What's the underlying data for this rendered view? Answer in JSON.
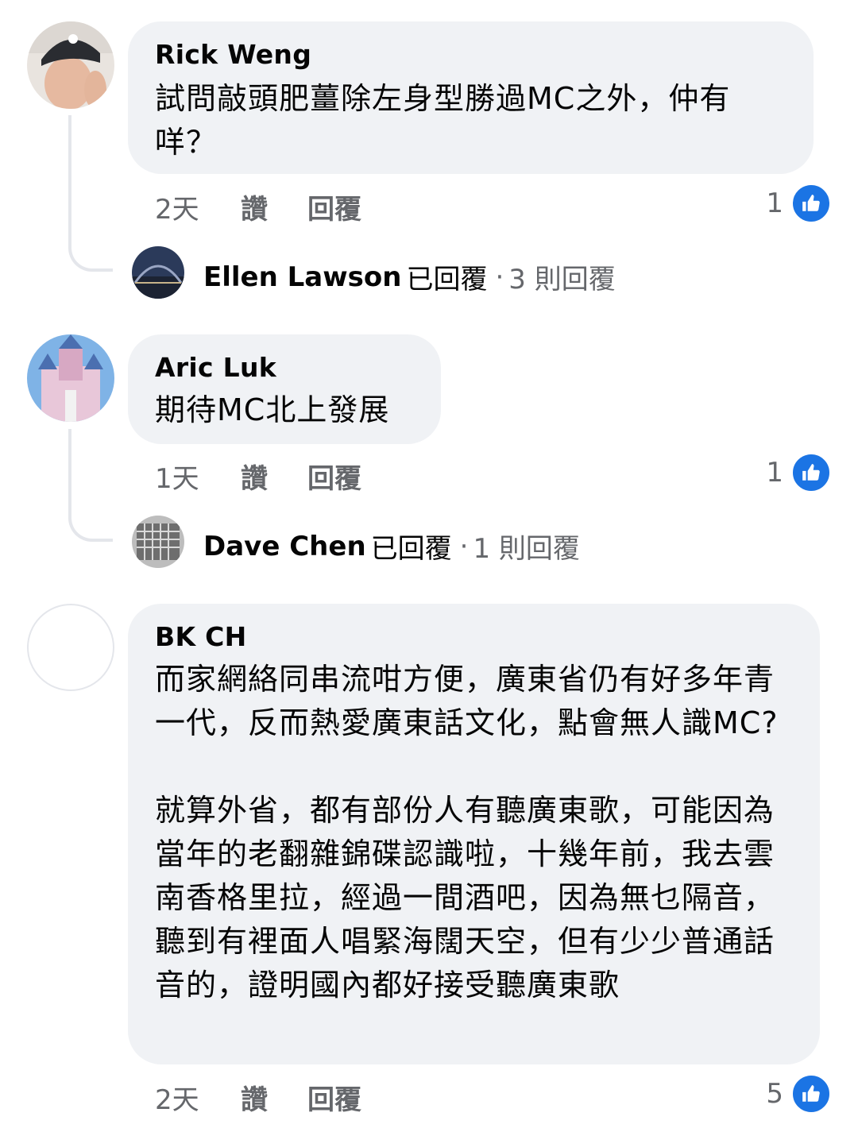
{
  "colors": {
    "bubble_bg": "#f0f2f5",
    "meta_text": "#65676b",
    "like_blue": "#1b74e4",
    "thread_line": "#e4e6eb"
  },
  "comments": [
    {
      "author": "Rick  Weng",
      "text": "試問敲頭肥薑除左身型勝過MC之外，仲有咩？",
      "time": "2天",
      "like_label": "讚",
      "reply_label": "回覆",
      "reaction_count": "1",
      "reaction_icon": "like-icon",
      "replies_preview": {
        "name": "Ellen Lawson",
        "action": "已回覆",
        "dot": "·",
        "count": "3 則回覆"
      }
    },
    {
      "author": "Aric Luk",
      "text": "期待MC北上發展",
      "time": "1天",
      "like_label": "讚",
      "reply_label": "回覆",
      "reaction_count": "1",
      "reaction_icon": "like-icon",
      "replies_preview": {
        "name": "Dave Chen",
        "action": "已回覆",
        "dot": "·",
        "count": "1 則回覆"
      }
    },
    {
      "author": "BK CH",
      "text": "而家網絡同串流咁方便，廣東省仍有好多年青一代，反而熱愛廣東話文化，點會無人識MC?\n\n就算外省，都有部份人有聽廣東歌，可能因為當年的老翻雜錦碟認識啦，十幾年前，我去雲南香格里拉，經過一間酒吧，因為無乜隔音，聽到有裡面人唱緊海闊天空，但有少少普通話音的，證明國內都好接受聽廣東歌",
      "time": "2天",
      "like_label": "讚",
      "reply_label": "回覆",
      "reaction_count": "5",
      "reaction_icon": "like-icon"
    }
  ]
}
